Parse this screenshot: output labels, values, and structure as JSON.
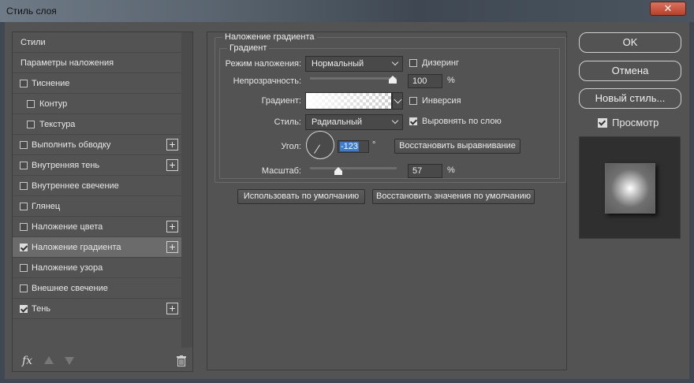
{
  "window": {
    "title": "Стиль слоя",
    "close": "✕"
  },
  "left": {
    "items": [
      {
        "label": "Стили",
        "checkbox": false
      },
      {
        "label": "Параметры наложения",
        "checkbox": false
      },
      {
        "label": "Тиснение",
        "checkbox": true,
        "checked": false
      },
      {
        "label": "Контур",
        "checkbox": true,
        "checked": false,
        "indent": true
      },
      {
        "label": "Текстура",
        "checkbox": true,
        "checked": false,
        "indent": true
      },
      {
        "label": "Выполнить обводку",
        "checkbox": true,
        "checked": false,
        "plus": true
      },
      {
        "label": "Внутренняя тень",
        "checkbox": true,
        "checked": false,
        "plus": true
      },
      {
        "label": "Внутреннее свечение",
        "checkbox": true,
        "checked": false
      },
      {
        "label": "Глянец",
        "checkbox": true,
        "checked": false
      },
      {
        "label": "Наложение цвета",
        "checkbox": true,
        "checked": false,
        "plus": true
      },
      {
        "label": "Наложение градиента",
        "checkbox": true,
        "checked": true,
        "plus": true,
        "selected": true
      },
      {
        "label": "Наложение узора",
        "checkbox": true,
        "checked": false
      },
      {
        "label": "Внешнее свечение",
        "checkbox": true,
        "checked": false
      },
      {
        "label": "Тень",
        "checkbox": true,
        "checked": true,
        "plus": true
      }
    ],
    "fx_label": "fx",
    "icons": [
      "fx-icon",
      "move-up-icon",
      "move-down-icon",
      "trash-icon"
    ]
  },
  "gradient_overlay": {
    "section_title": "Наложение градиента",
    "group_title": "Градиент",
    "blend_mode": {
      "label": "Режим наложения:",
      "value": "Нормальный"
    },
    "dither": {
      "label": "Дизеринг",
      "checked": false
    },
    "opacity": {
      "label": "Непрозрачность:",
      "value": "100",
      "unit": "%",
      "level": 1.0
    },
    "gradient": {
      "label": "Градиент:"
    },
    "reverse": {
      "label": "Инверсия",
      "checked": false
    },
    "style": {
      "label": "Стиль:",
      "value": "Радиальный"
    },
    "align": {
      "label": "Выровнять по слою",
      "checked": true
    },
    "angle": {
      "label": "Угол:",
      "value": "-123",
      "unit": "°"
    },
    "reset_align": "Восстановить выравнивание",
    "scale": {
      "label": "Масштаб:",
      "value": "57",
      "unit": "%",
      "level": 0.57
    },
    "make_default": "Использовать по умолчанию",
    "reset_default": "Восстановить значения по умолчанию"
  },
  "right": {
    "ok": "OK",
    "cancel": "Отмена",
    "new_style": "Новый стиль...",
    "preview": {
      "label": "Просмотр",
      "checked": true
    }
  }
}
